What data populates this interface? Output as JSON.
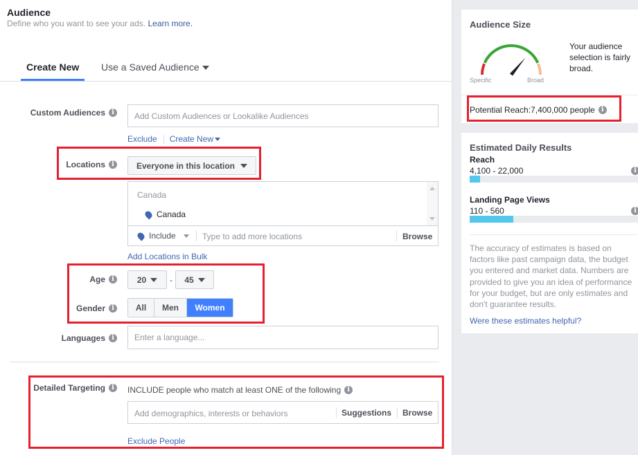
{
  "header": {
    "title": "Audience",
    "subtitle": "Define who you want to see your ads.",
    "learn_more": "Learn more."
  },
  "tabs": [
    {
      "label": "Create New",
      "active": true
    },
    {
      "label": "Use a Saved Audience",
      "active": false
    }
  ],
  "custom_audiences": {
    "label": "Custom Audiences",
    "placeholder": "Add Custom Audiences or Lookalike Audiences",
    "exclude_link": "Exclude",
    "create_new_link": "Create New"
  },
  "locations": {
    "label": "Locations",
    "dropdown_value": "Everyone in this location",
    "group_header": "Canada",
    "selected": [
      "Canada"
    ],
    "include_value": "Include",
    "search_placeholder": "Type to add more locations",
    "browse_label": "Browse",
    "bulk_link": "Add Locations in Bulk"
  },
  "age": {
    "label": "Age",
    "min": "20",
    "max": "45",
    "separator": "-"
  },
  "gender": {
    "label": "Gender",
    "options": [
      "All",
      "Men",
      "Women"
    ],
    "selected": "Women"
  },
  "languages": {
    "label": "Languages",
    "placeholder": "Enter a language..."
  },
  "detailed_targeting": {
    "label": "Detailed Targeting",
    "include_text": "INCLUDE people who match at least ONE of the following",
    "placeholder": "Add demographics, interests or behaviors",
    "suggestions_label": "Suggestions",
    "browse_label": "Browse",
    "exclude_link": "Exclude People"
  },
  "audience_size": {
    "title": "Audience Size",
    "description": "Your audience selection is fairly broad.",
    "gauge_specific": "Specific",
    "gauge_broad": "Broad",
    "gauge_level": 0.72,
    "potential_reach": "Potential Reach:7,400,000 people"
  },
  "daily_results": {
    "title": "Estimated Daily Results",
    "metrics": [
      {
        "label": "Reach",
        "range": "4,100 - 22,000",
        "fill": 0.06
      },
      {
        "label": "Landing Page Views",
        "range": "110 - 560",
        "fill": 0.26
      }
    ],
    "disclaimer": "The accuracy of estimates is based on factors like past campaign data, the budget you entered and market data. Numbers are provided to give you an idea of performance for your budget, but are only estimates and don't guarantee results.",
    "feedback_link": "Were these estimates helpful?"
  },
  "colors": {
    "accent": "#4080ff",
    "link": "#4267b2",
    "highlight": "#e5202e",
    "bar": "#54c7ec",
    "gauge_red": "#d0312d",
    "gauge_green": "#3aa535",
    "gauge_peach": "#f5bc91"
  }
}
